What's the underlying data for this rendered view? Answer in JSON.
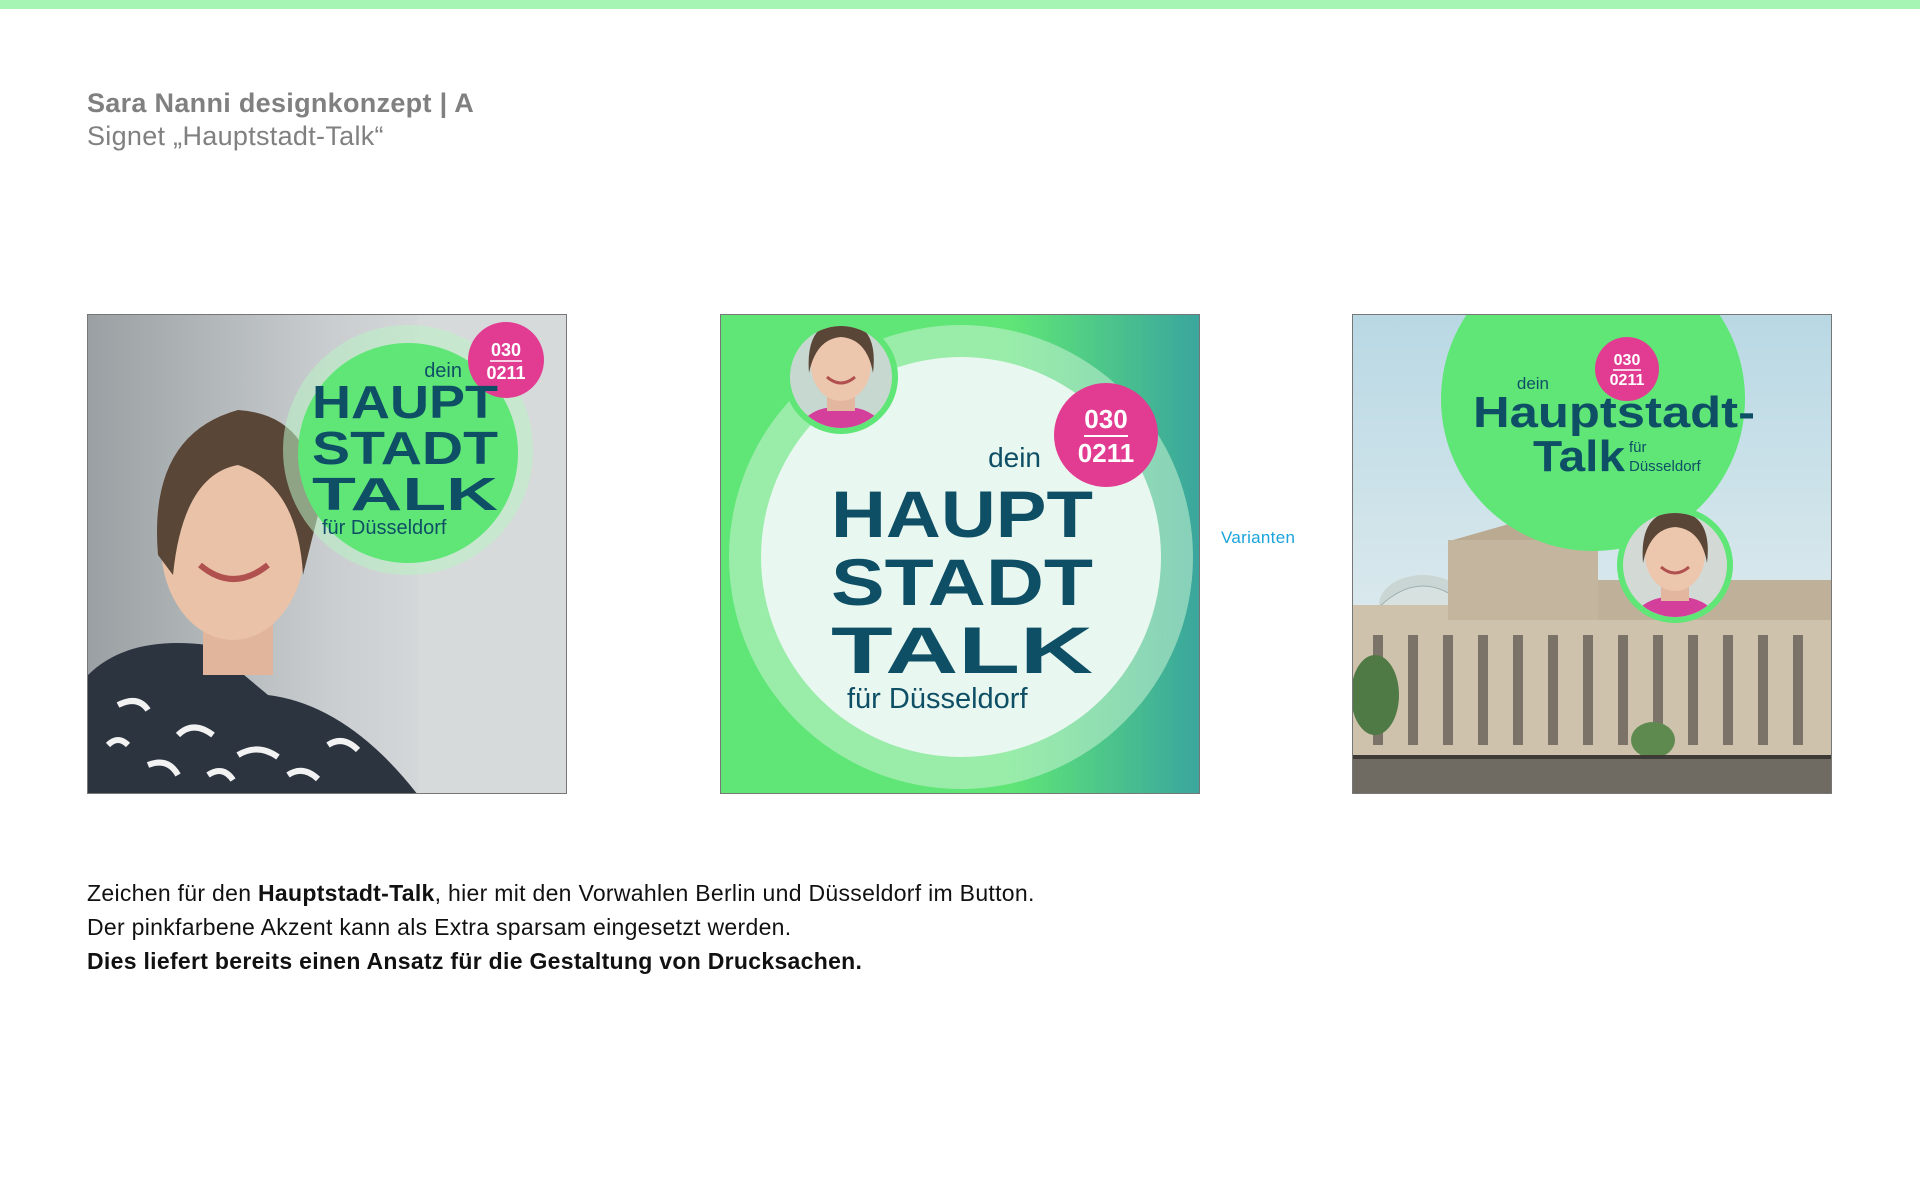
{
  "header": {
    "title": "Sara Nanni designkonzept | A",
    "subtitle": "Signet „Hauptstadt-Talk“"
  },
  "signet": {
    "dein": "dein",
    "haupt": "HAUPT",
    "stadt": "STADT",
    "talk": "TALK",
    "fuer_duesseldorf": "für Düsseldorf",
    "code_berlin": "030",
    "code_duesseldorf": "0211",
    "variant_title_line1": "Hauptstadt-",
    "variant_title_line2": "Talk",
    "variant_fuer": "für",
    "variant_duesseldorf": "Düsseldorf"
  },
  "variants_label": "Varianten",
  "description": {
    "line1_before": "Zeichen für den ",
    "line1_bold": "Hauptstadt-Talk",
    "line1_after": ", hier mit den Vorwahlen Berlin und Düsseldorf im Button.",
    "line2": "Der pinkfarbene Akzent kann als Extra sparsam eingesetzt werden.",
    "line3": "Dies liefert bereits einen Ansatz für die Gestaltung von Drucksachen."
  },
  "colors": {
    "accent_green": "#5fe676",
    "topbar_green": "#a6f5b4",
    "text_navy": "#0e4f66",
    "pink": "#e23c92",
    "teal": "#3aa59e",
    "label_blue": "#1aa3dc"
  },
  "icons": [
    "portrait-photo",
    "reichstag-photo"
  ]
}
